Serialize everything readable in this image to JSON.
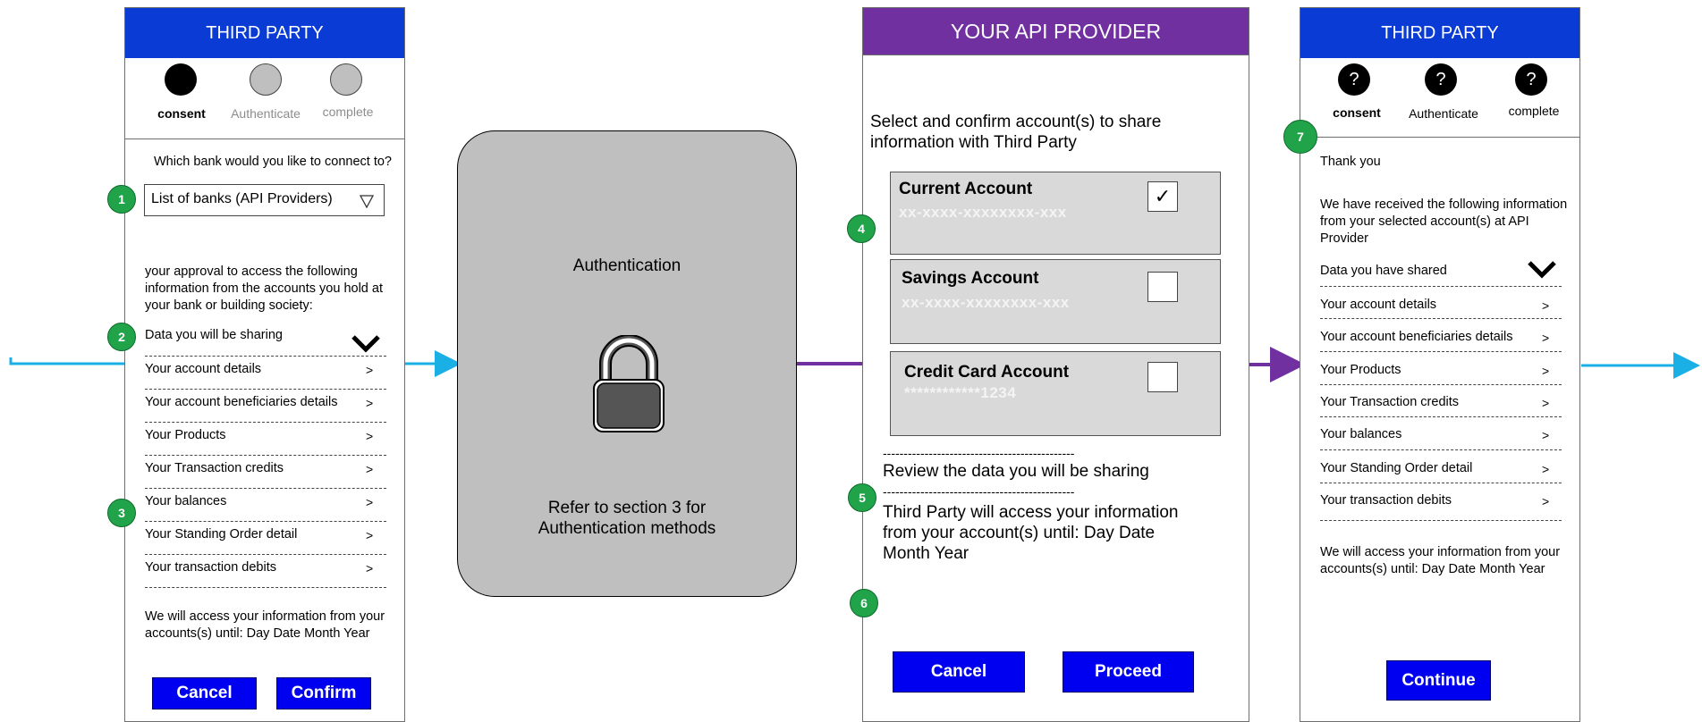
{
  "screen1": {
    "header": "THIRD PARTY",
    "steps": [
      "consent",
      "Authenticate",
      "complete"
    ],
    "question": "Which bank would you like to connect to?",
    "bank_select": "List of banks (API Providers)",
    "approval_text": [
      "your approval to access the following",
      "information from the accounts you hold at",
      "your bank or building society:"
    ],
    "data_header": "Data you will be sharing",
    "items": [
      "Your account details",
      "Your account beneficiaries details",
      "Your Products",
      "Your Transaction credits",
      "Your balances",
      "Your Standing Order detail",
      "Your transaction debits"
    ],
    "chevron": ">",
    "access_text": [
      "We will access your information from your",
      "accounts(s) until: Day Date Month Year"
    ],
    "cancel": "Cancel",
    "confirm": "Confirm"
  },
  "screen2": {
    "title": "Authentication",
    "refer": [
      "Refer to section 3 for",
      "Authentication methods"
    ]
  },
  "screen3": {
    "header": "YOUR API PROVIDER",
    "intro": [
      "Select and confirm account(s) to share",
      "information with Third Party"
    ],
    "accounts": [
      {
        "name": "Current Account",
        "number": "xx-xxxx-xxxxxxxx-xxx",
        "checked": "✓"
      },
      {
        "name": "Savings Account",
        "number": "xx-xxxx-xxxxxxxx-xxx",
        "checked": ""
      },
      {
        "name": "Credit Card Account",
        "number": "************1234",
        "checked": ""
      }
    ],
    "dashes": "----------------------------------------------",
    "review": "Review the data you will be sharing",
    "access_text": [
      "Third Party will access your information",
      "from your account(s) until: Day Date",
      "Month Year"
    ],
    "cancel": "Cancel",
    "proceed": "Proceed"
  },
  "screen4": {
    "header": "THIRD PARTY",
    "steps": [
      "consent",
      "Authenticate",
      "complete"
    ],
    "step_glyph": "?",
    "thanks": "Thank you",
    "received": [
      "We have received the following information",
      "from your selected account(s) at API",
      "Provider"
    ],
    "data_header": "Data you have shared",
    "items": [
      "Your account details",
      "Your account beneficiaries details",
      "Your Products",
      "Your Transaction credits",
      "Your balances",
      "Your Standing Order detail",
      "Your transaction debits"
    ],
    "chevron": ">",
    "access_text": [
      "We will access your information from your",
      "accounts(s) until: Day Date Month Year"
    ],
    "continue": "Continue"
  },
  "badges": [
    "1",
    "2",
    "3",
    "4",
    "5",
    "6",
    "7"
  ],
  "colors": {
    "third_party_header": "#0a3bd4",
    "provider_header": "#7030a0",
    "button": "#0000f0",
    "badge": "#21a34a",
    "arrow_blue": "#1ab0e6",
    "arrow_purple": "#7030a0",
    "auth_panel": "#bfbfbf"
  }
}
